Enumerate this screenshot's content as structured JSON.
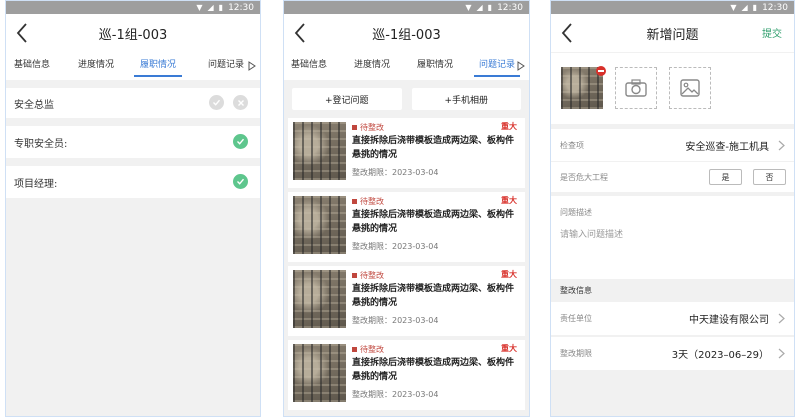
{
  "status_bar": {
    "time": "12:30"
  },
  "screen_progress": {
    "title": "巡-1组-003",
    "tabs": [
      "基础信息",
      "进度情况",
      "履职情况",
      "问题记录"
    ],
    "active_tab": "履职情况",
    "rows": [
      {
        "label": "安全总监",
        "status": "unchecked"
      },
      {
        "label": "专职安全员:",
        "status": "checked"
      },
      {
        "label": "项目经理:",
        "status": "checked"
      }
    ]
  },
  "screen_issues": {
    "title": "巡-1组-003",
    "tabs": [
      "基础信息",
      "进度情况",
      "履职情况",
      "问题记录"
    ],
    "active_tab": "问题记录",
    "register_button": "+登记问题",
    "album_button": "+手机相册",
    "cards": [
      {
        "status": "待整改",
        "level": "重大",
        "title": "直接拆除后浇带模板造成两边梁、板构件悬挑的情况",
        "deadline": "整改期限：2023-03-04"
      },
      {
        "status": "待整改",
        "level": "重大",
        "title": "直接拆除后浇带模板造成两边梁、板构件悬挑的情况",
        "deadline": "整改期限：2023-03-04"
      },
      {
        "status": "待整改",
        "level": "重大",
        "title": "直接拆除后浇带模板造成两边梁、板构件悬挑的情况",
        "deadline": "整改期限：2023-03-04"
      },
      {
        "status": "待整改",
        "level": "重大",
        "title": "直接拆除后浇带模板造成两边梁、板构件悬挑的情况",
        "deadline": "整改期限：2023-03-04"
      }
    ]
  },
  "screen_new_issue": {
    "title": "新增问题",
    "submit": "提交",
    "inspection_label": "检查项",
    "inspection_value": "安全巡查-施工机具",
    "major_label": "是否危大工程",
    "yes_label": "是",
    "no_label": "否",
    "desc_label": "问题描述",
    "desc_placeholder": "请输入问题描述",
    "section_label": "整改信息",
    "unit_label": "责任单位",
    "unit_value": "中天建设有限公司",
    "deadline_label": "整改期限",
    "deadline_value": "3天（2023–06–29）"
  },
  "colors": {
    "accent_blue": "#3a7bd5",
    "check_green": "#5ec68d",
    "danger_red": "#d8302a",
    "submit_green": "#2f9e6c"
  }
}
